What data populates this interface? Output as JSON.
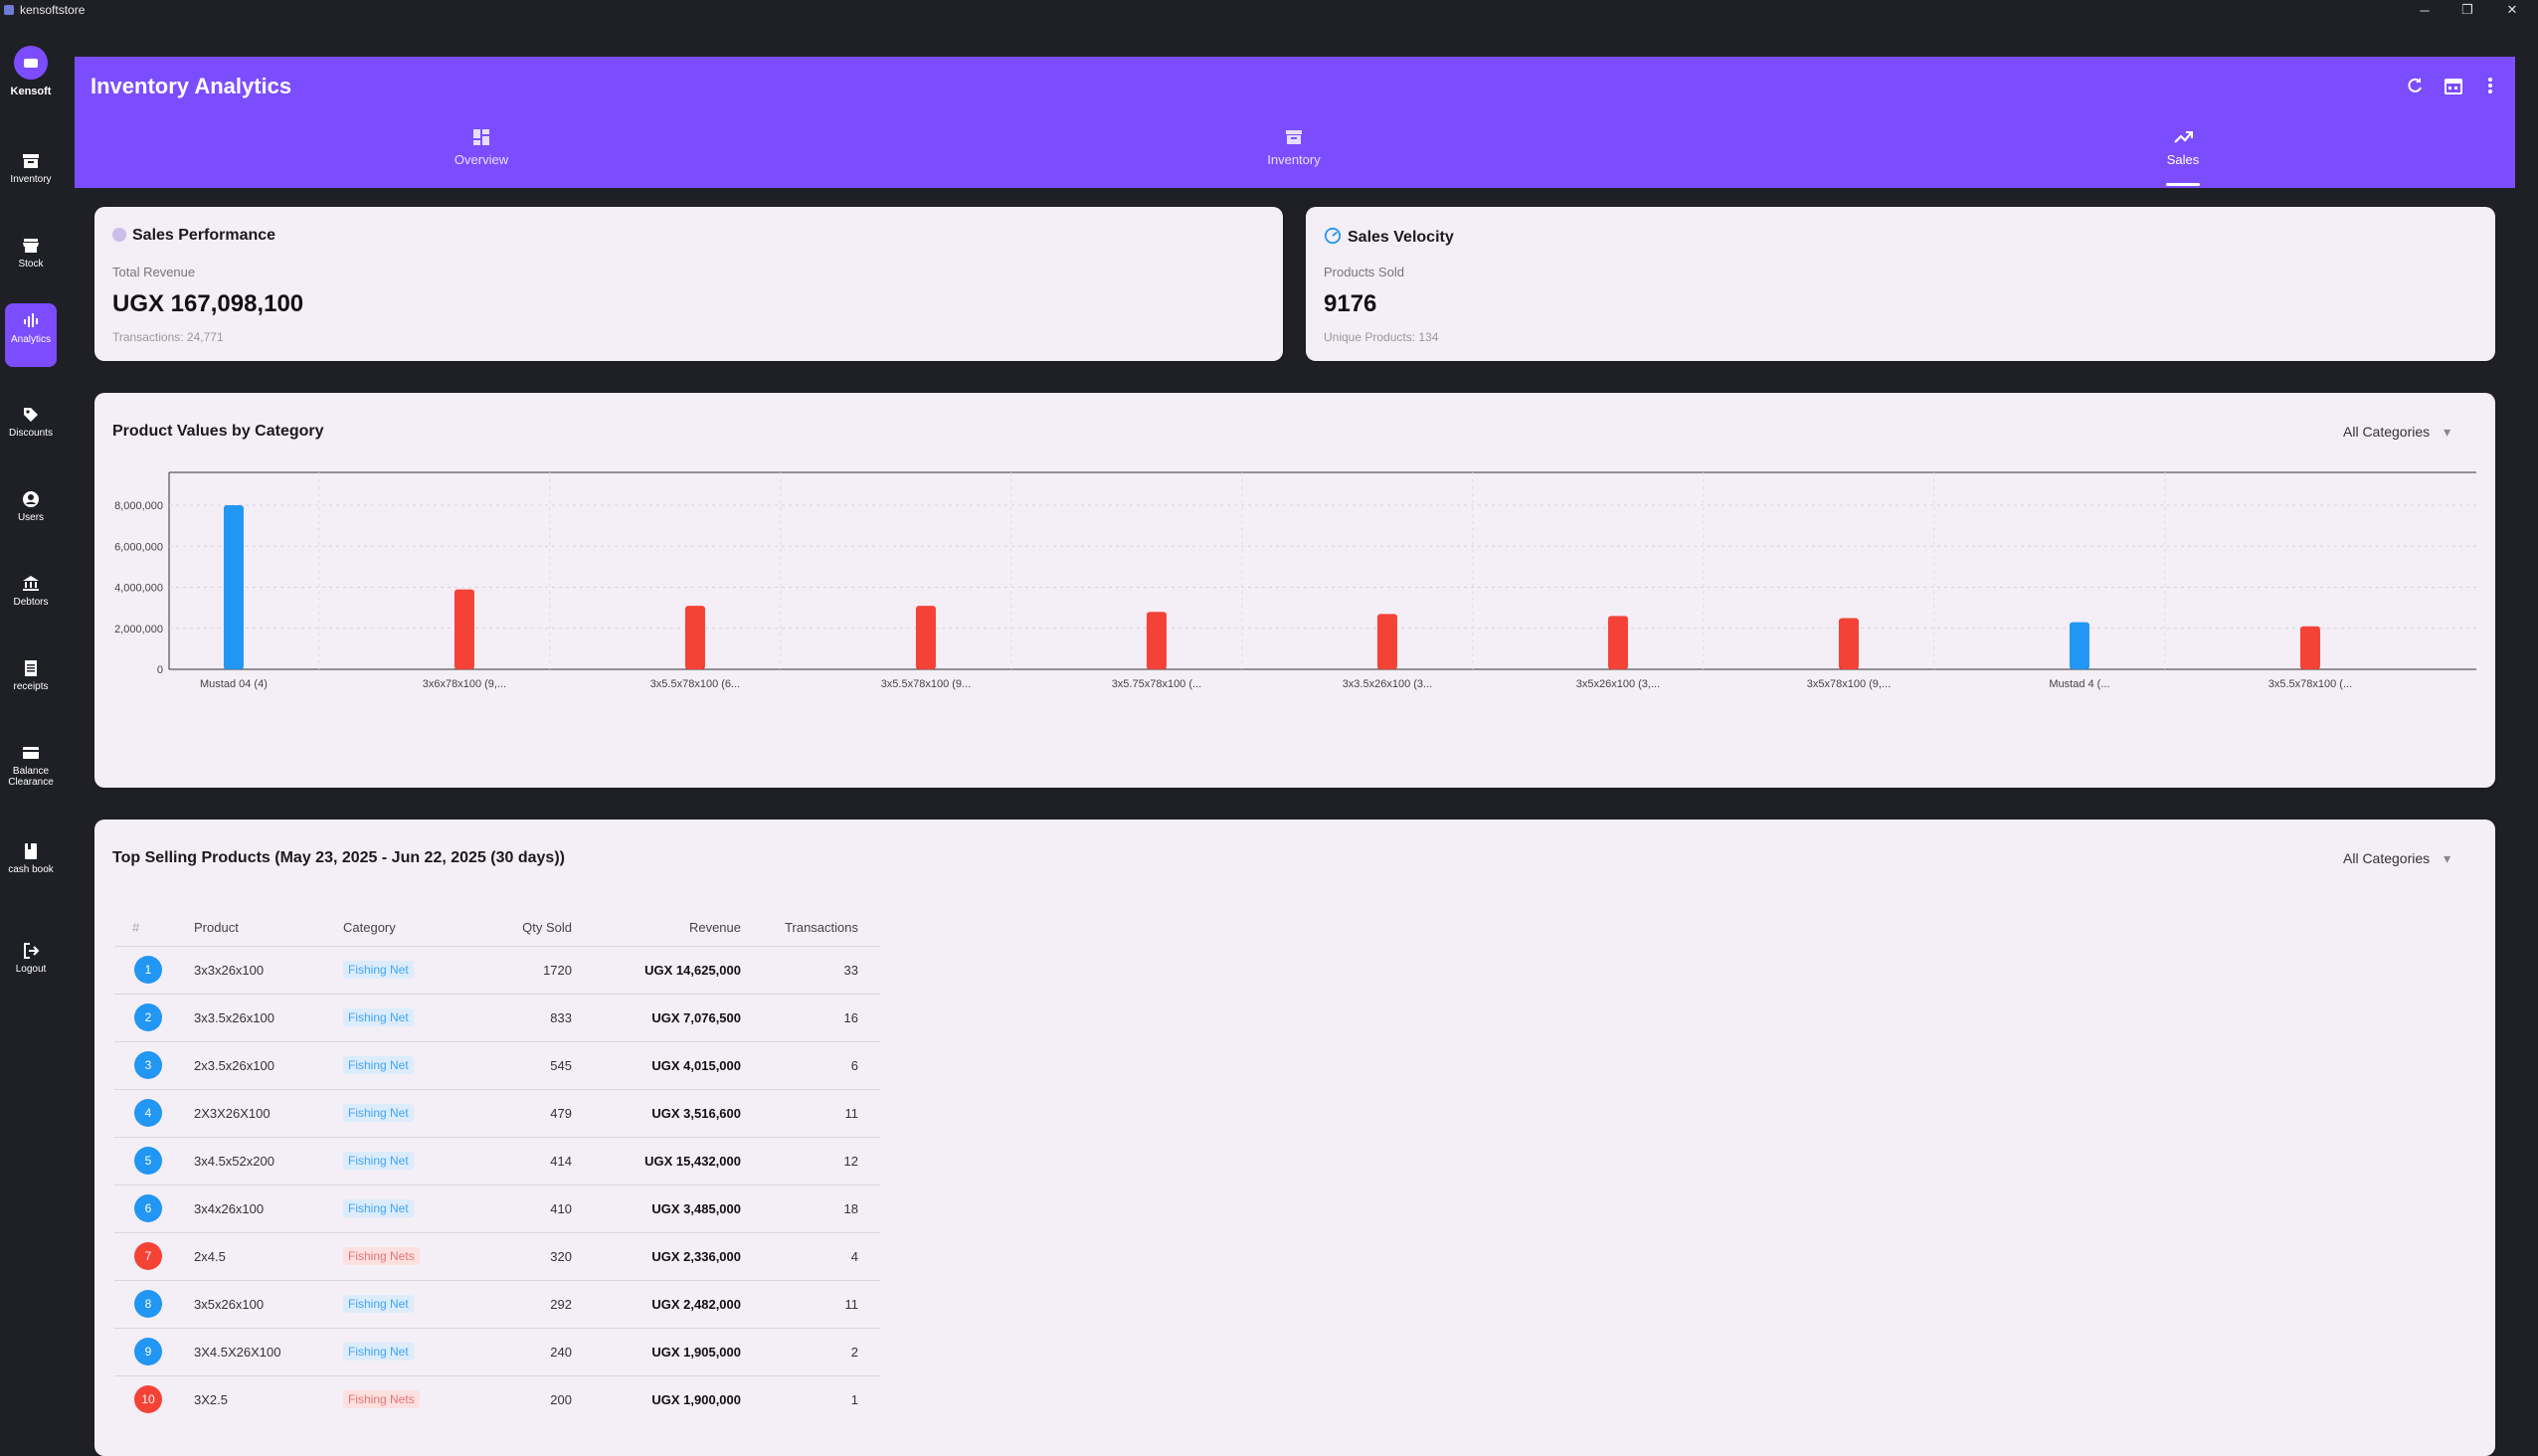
{
  "window": {
    "title": "kensoftstore",
    "min": "─",
    "max": "❐",
    "close": "✕"
  },
  "brand": {
    "name": "Kensoft"
  },
  "sidebar": {
    "items": [
      {
        "label": "Inventory",
        "icon": "archive-icon"
      },
      {
        "label": "Stock",
        "icon": "store-icon"
      },
      {
        "label": "Analytics",
        "icon": "analytics-icon",
        "active": true
      },
      {
        "label": "Discounts",
        "icon": "tag-icon"
      },
      {
        "label": "Users",
        "icon": "user-icon"
      },
      {
        "label": "Debtors",
        "icon": "bank-icon"
      },
      {
        "label": "receipts",
        "icon": "receipt-icon"
      },
      {
        "label": "Balance Clearance",
        "icon": "balance-icon"
      },
      {
        "label": "cash book",
        "icon": "book-icon"
      },
      {
        "label": "Logout",
        "icon": "logout-icon"
      }
    ]
  },
  "header": {
    "title": "Inventory Analytics",
    "tabs": [
      {
        "label": "Overview",
        "icon": "dashboard-icon"
      },
      {
        "label": "Inventory",
        "icon": "archive-icon"
      },
      {
        "label": "Sales",
        "icon": "trending-up-icon",
        "active": true
      }
    ]
  },
  "sales_performance": {
    "title": "Sales Performance",
    "label": "Total Revenue",
    "value": "UGX 167,098,100",
    "sub": "Transactions: 24,771"
  },
  "sales_velocity": {
    "title": "Sales Velocity",
    "label": "Products Sold",
    "value": "9176",
    "sub": "Unique Products: 134"
  },
  "category_chart": {
    "title": "Product Values by Category",
    "filter": "All Categories"
  },
  "chart_data": {
    "type": "bar",
    "title": "Product Values by Category",
    "categories": [
      "Mustad 04 (4)",
      "3x6x78x100 (9,...",
      "3x5.5x78x100 (6...",
      "3x5.5x78x100 (9...",
      "3x5.75x78x100 (...",
      "3x3.5x26x100 (3...",
      "3x5x26x100 (3,...",
      "3x5x78x100 (9,...",
      "Mustad 4 (...",
      "3x5.5x78x100 (..."
    ],
    "series": [
      {
        "color": "#2196f3",
        "values": [
          8000000,
          0,
          0,
          0,
          0,
          0,
          0,
          0,
          2300000,
          0
        ]
      },
      {
        "color": "#f44336",
        "values": [
          0,
          3900000,
          3100000,
          3100000,
          2800000,
          2700000,
          2600000,
          2500000,
          0,
          2100000
        ]
      }
    ],
    "yticks": [
      "0",
      "2,000,000",
      "4,000,000",
      "6,000,000",
      "8,000,000"
    ],
    "ylim": [
      0,
      9600000
    ],
    "grid": true
  },
  "top_selling": {
    "title": "Top Selling Products (May 23, 2025 - Jun 22, 2025 (30 days))",
    "filter": "All Categories",
    "columns": [
      "#",
      "Product",
      "Category",
      "Qty Sold",
      "Revenue",
      "Transactions"
    ],
    "rows": [
      {
        "rank": "1",
        "product": "3x3x26x100",
        "category": "Fishing Net",
        "qty": "1720",
        "revenue": "UGX 14,625,000",
        "tx": "33"
      },
      {
        "rank": "2",
        "product": "3x3.5x26x100",
        "category": "Fishing Net",
        "qty": "833",
        "revenue": "UGX 7,076,500",
        "tx": "16"
      },
      {
        "rank": "3",
        "product": "2x3.5x26x100",
        "category": "Fishing Net",
        "qty": "545",
        "revenue": "UGX 4,015,000",
        "tx": "6"
      },
      {
        "rank": "4",
        "product": "2X3X26X100",
        "category": "Fishing Net",
        "qty": "479",
        "revenue": "UGX 3,516,600",
        "tx": "11"
      },
      {
        "rank": "5",
        "product": "3x4.5x52x200",
        "category": "Fishing Net",
        "qty": "414",
        "revenue": "UGX 15,432,000",
        "tx": "12"
      },
      {
        "rank": "6",
        "product": "3x4x26x100",
        "category": "Fishing Net",
        "qty": "410",
        "revenue": "UGX 3,485,000",
        "tx": "18"
      },
      {
        "rank": "7",
        "product": "2x4.5",
        "category": "Fishing Nets",
        "qty": "320",
        "revenue": "UGX 2,336,000",
        "tx": "4"
      },
      {
        "rank": "8",
        "product": "3x5x26x100",
        "category": "Fishing Net",
        "qty": "292",
        "revenue": "UGX 2,482,000",
        "tx": "11"
      },
      {
        "rank": "9",
        "product": "3X4.5X26X100",
        "category": "Fishing Net",
        "qty": "240",
        "revenue": "UGX 1,905,000",
        "tx": "2"
      },
      {
        "rank": "10",
        "product": "3X2.5",
        "category": "Fishing Nets",
        "qty": "200",
        "revenue": "UGX 1,900,000",
        "tx": "1"
      }
    ]
  },
  "colors": {
    "accent": "#7c4dff",
    "blue": "#2196f3",
    "red": "#f44336",
    "card": "#f4eef6"
  }
}
